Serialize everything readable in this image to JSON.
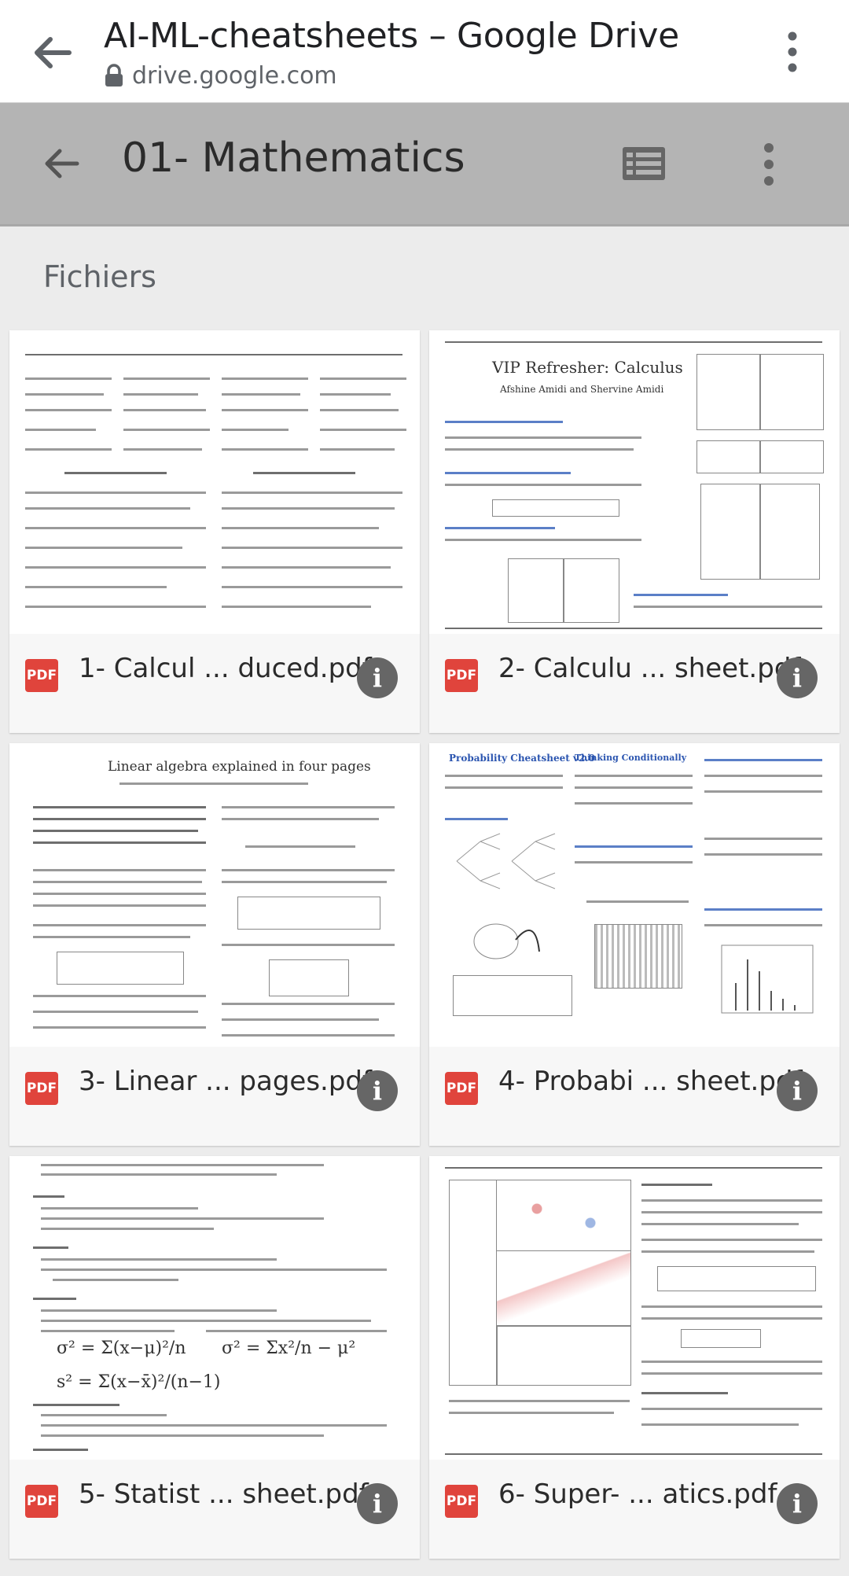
{
  "browser": {
    "title": "AI-ML-cheatsheets – Google Drive",
    "url": "drive.google.com"
  },
  "folder": {
    "title": "01- Mathematics"
  },
  "section_label": "Fichiers",
  "files": [
    {
      "name": "1- Calcul ... duced.pdf",
      "type": "PDF"
    },
    {
      "name": "2- Calculu ... sheet.pdf",
      "type": "PDF"
    },
    {
      "name": "3- Linear ... pages.pdf",
      "type": "PDF"
    },
    {
      "name": "4- Probabi ... sheet.pdf",
      "type": "PDF"
    },
    {
      "name": "5- Statist ... sheet.pdf",
      "type": "PDF"
    },
    {
      "name": "6- Super- ... atics.pdf",
      "type": "PDF"
    }
  ],
  "thumbnails": {
    "t2_title": "VIP Refresher: Calculus",
    "t2_authors": "Afshine Amidi and Shervine Amidi",
    "t3_title": "Linear algebra explained in four pages",
    "t4_title": "Probability Cheatsheet v2.0",
    "t4_section": "Thinking Conditionally"
  },
  "colors": {
    "pdf_badge": "#e0443c",
    "app_bar": "#b4b4b4",
    "info_button": "#666666"
  },
  "icons": {
    "back": "arrow-back-icon",
    "lock": "lock-icon",
    "more": "more-vert-icon",
    "list": "list-view-icon",
    "info": "info-icon"
  }
}
